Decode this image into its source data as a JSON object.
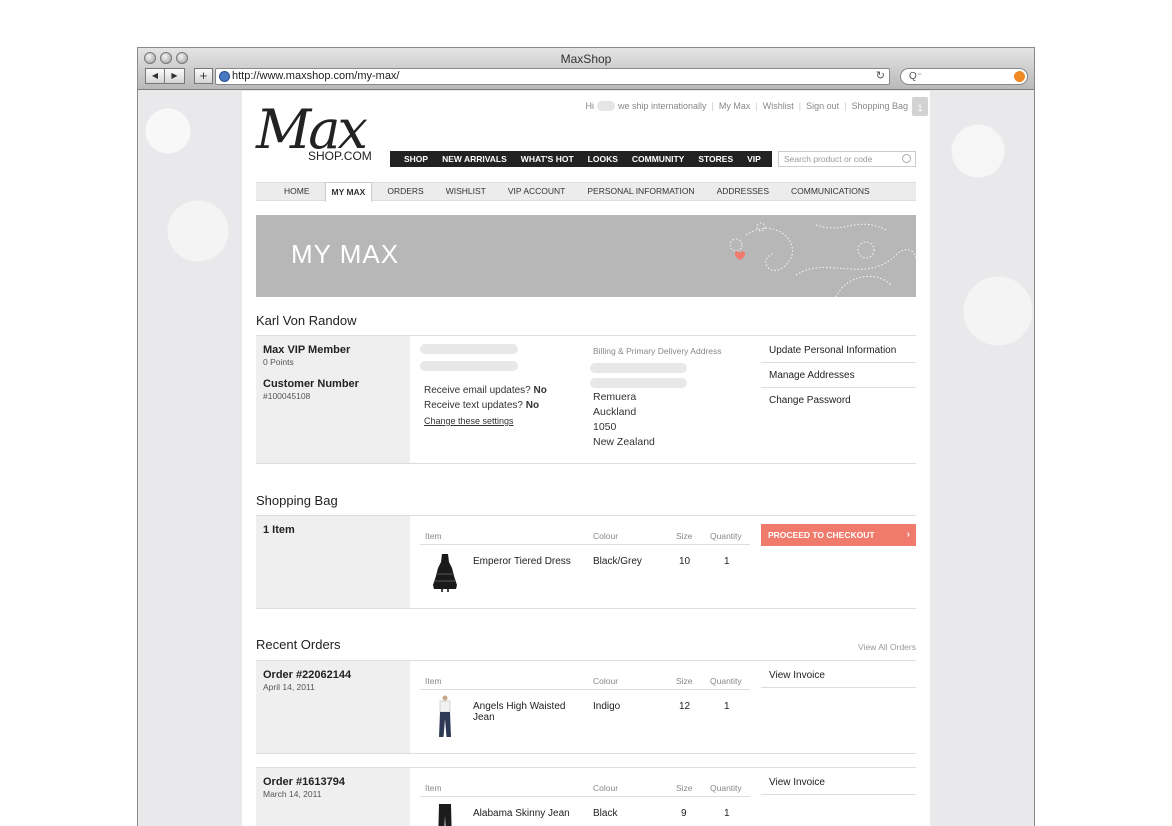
{
  "browser": {
    "title": "MaxShop",
    "url": "http://www.maxshop.com/my-max/",
    "back_glyph": "◀",
    "forward_glyph": "▶",
    "add_glyph": "+",
    "reload_glyph": "↻",
    "search_glyph": "Q⁻"
  },
  "header": {
    "logo_script": "Max",
    "logo_sub": "SHOP.COM",
    "hi_label": "Hi",
    "ship_label": "we ship internationally",
    "links": [
      "My Max",
      "Wishlist",
      "Sign out",
      "Shopping Bag"
    ],
    "bag_count": "1"
  },
  "main_nav": [
    "SHOP",
    "NEW ARRIVALS",
    "WHAT'S HOT",
    "LOOKS",
    "COMMUNITY",
    "STORES",
    "VIP"
  ],
  "search": {
    "placeholder": "Search product or code"
  },
  "sub_nav": [
    "HOME",
    "MY MAX",
    "ORDERS",
    "WISHLIST",
    "VIP ACCOUNT",
    "PERSONAL INFORMATION",
    "ADDRESSES",
    "COMMUNICATIONS"
  ],
  "banner": {
    "title": "MY MAX"
  },
  "account": {
    "name": "Karl Von Randow",
    "membership": "Max VIP Member",
    "points": "0 Points",
    "customer_label": "Customer Number",
    "customer_number": "#100045108",
    "email_label": "Receive email updates?",
    "email_value": "No",
    "text_label": "Receive text updates?",
    "text_value": "No",
    "change_settings": "Change these settings",
    "address_label": "Billing & Primary Delivery Address",
    "address_lines": [
      "Remuera",
      "Auckland",
      "1050",
      "New Zealand"
    ],
    "links": [
      "Update Personal Information",
      "Manage Addresses",
      "Change Password"
    ]
  },
  "table_headers": {
    "item": "Item",
    "colour": "Colour",
    "size": "Size",
    "quantity": "Quantity"
  },
  "shopping_bag": {
    "title": "Shopping Bag",
    "count": "1 Item",
    "checkout_label": "PROCEED TO CHECKOUT",
    "checkout_arrow": "›",
    "items": [
      {
        "name": "Emperor Tiered Dress",
        "colour": "Black/Grey",
        "size": "10",
        "quantity": "1"
      }
    ]
  },
  "recent_orders": {
    "title": "Recent Orders",
    "view_all": "View All Orders",
    "invoice_label": "View Invoice",
    "orders": [
      {
        "number": "Order #22062144",
        "date": "April 14, 2011",
        "item": {
          "name_line1": "Angels High Waisted",
          "name_line2": "Jean",
          "colour": "Indigo",
          "size": "12",
          "quantity": "1"
        }
      },
      {
        "number": "Order #1613794",
        "date": "March 14, 2011",
        "item": {
          "name_line1": "Alabama Skinny Jean",
          "name_line2": "",
          "colour": "Black",
          "size": "9",
          "quantity": "1"
        }
      }
    ]
  },
  "colors": {
    "accent": "#f07b6c",
    "nav_bg": "#222222",
    "banner_bg": "#b7b7b8"
  }
}
